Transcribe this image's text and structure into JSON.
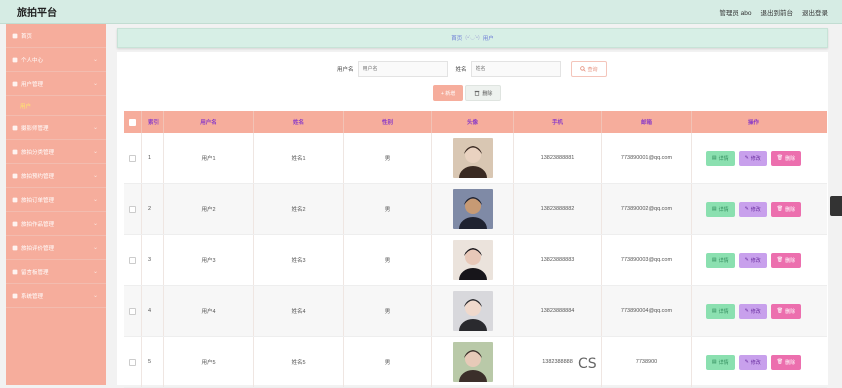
{
  "header": {
    "title": "旅拍平台",
    "links": [
      "管理员 abo",
      "退出到前台",
      "退出登录"
    ]
  },
  "sidebar": {
    "items": [
      {
        "label": "首页",
        "icon": "home-icon",
        "chevron": false
      },
      {
        "label": "个人中心",
        "icon": "person-icon",
        "chevron": true
      },
      {
        "label": "用户管理",
        "icon": "user-icon",
        "chevron": true,
        "sub": "用户"
      },
      {
        "label": "摄影师管理",
        "icon": "camera-icon",
        "chevron": true
      },
      {
        "label": "旅拍分类管理",
        "icon": "grid-icon",
        "chevron": true
      },
      {
        "label": "旅拍预约管理",
        "icon": "calendar-icon",
        "chevron": true
      },
      {
        "label": "旅拍订单管理",
        "icon": "order-icon",
        "chevron": true
      },
      {
        "label": "旅拍作品管理",
        "icon": "works-icon",
        "chevron": true
      },
      {
        "label": "旅拍评价管理",
        "icon": "comment-icon",
        "chevron": true
      },
      {
        "label": "留言板管理",
        "icon": "board-icon",
        "chevron": true
      },
      {
        "label": "系统管理",
        "icon": "system-icon",
        "chevron": true
      }
    ]
  },
  "breadcrumb": {
    "home": "首页",
    "face": "(•'◡'•)",
    "current": "用户"
  },
  "search": {
    "username_label": "用户名",
    "username_placeholder": "用户名",
    "name_label": "姓名",
    "name_placeholder": "姓名",
    "query_label": "查询"
  },
  "toolbar": {
    "add_label": "+ 新增",
    "delete_label": "删除"
  },
  "table": {
    "headers": [
      "索引",
      "用户名",
      "姓名",
      "性别",
      "头像",
      "手机",
      "邮箱",
      "操作"
    ],
    "rows": [
      {
        "index": "1",
        "username": "用户1",
        "name": "姓名1",
        "sex": "男",
        "phone": "13823888881",
        "email": "773890001@qq.com"
      },
      {
        "index": "2",
        "username": "用户2",
        "name": "姓名2",
        "sex": "男",
        "phone": "13823888882",
        "email": "773890002@qq.com"
      },
      {
        "index": "3",
        "username": "用户3",
        "name": "姓名3",
        "sex": "男",
        "phone": "13823888883",
        "email": "773890003@qq.com"
      },
      {
        "index": "4",
        "username": "用户4",
        "name": "姓名4",
        "sex": "男",
        "phone": "13823888884",
        "email": "773890004@qq.com"
      },
      {
        "index": "5",
        "username": "用户5",
        "name": "姓名5",
        "sex": "男",
        "phone": "1382388888",
        "email": "7738900"
      }
    ],
    "ops": {
      "detail": "详情",
      "edit": "修改",
      "remove": "删除"
    }
  },
  "watermark": "CS",
  "colors": {
    "accent": "#f6ad9c",
    "header_bg": "#d6ece4",
    "sub_active": "#ffe76a",
    "detail": "#8be0b0",
    "edit": "#c8a0ec",
    "remove": "#ec6fae"
  }
}
